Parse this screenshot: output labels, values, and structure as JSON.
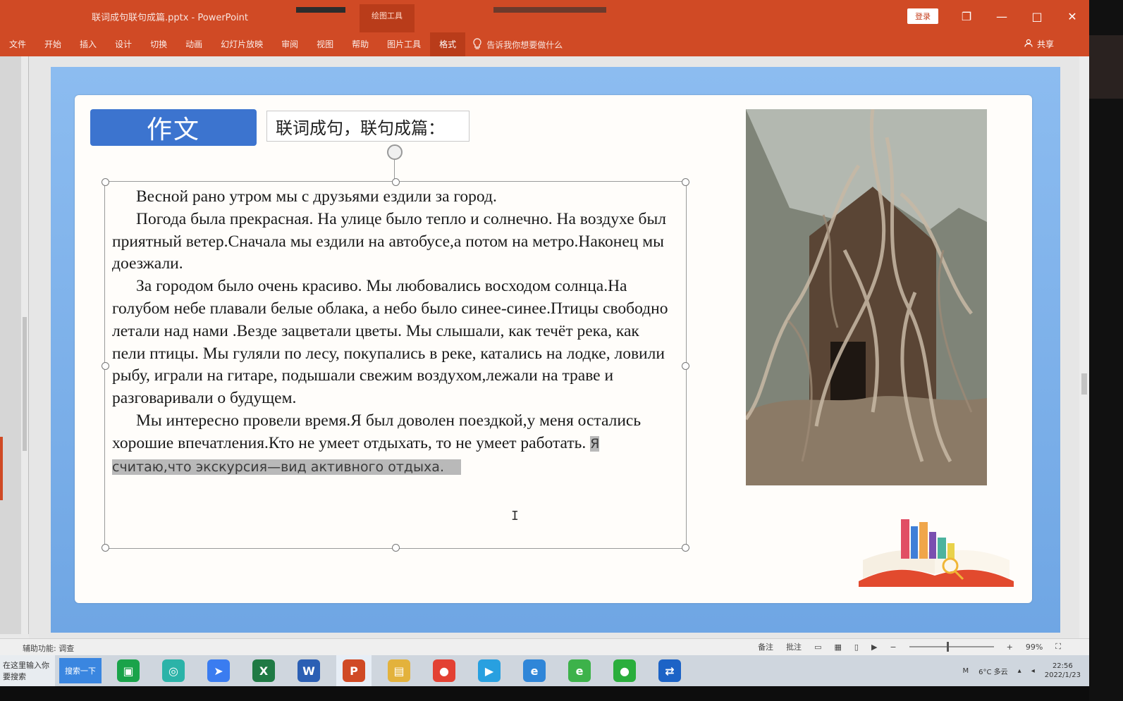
{
  "titlebar": {
    "doc_title": "联词成句联句成篇.pptx - PowerPoint",
    "context_tab": "绘图工具",
    "signin": "登录",
    "restore_icon": "❐",
    "minimize_icon": "—",
    "maximize_icon": "□",
    "close_icon": "✕"
  },
  "ribbon": {
    "tabs": [
      "文件",
      "开始",
      "插入",
      "设计",
      "切换",
      "动画",
      "幻灯片放映",
      "审阅",
      "视图",
      "帮助",
      "图片工具",
      "格式"
    ],
    "active_tab_index": 11,
    "tell_me": "告诉我你想要做什么",
    "share": "共享"
  },
  "slide": {
    "heading": "作文",
    "subtitle": "联词成句，联句成篇：",
    "paragraphs": [
      "Весной рано утром мы с друзьями ездили за город.",
      "Погода была прекрасная. На улице было тепло и солнечно. На воздухе был приятный ветер.Сначала мы ездили на автобусе,а потом на метро.Наконец мы доезжали.",
      "За городом было очень красиво. Мы любовались восходом солнца.На голубом небе плавали белые облака, а небо было синее-синее.Птицы свободно летали над нами .Везде зацветали цветы. Мы слышали, как течёт река, как пели птицы. Мы гуляли по лесу, покупались в реке, катались на лодке, ловили рыбу, играли на гитаре, подышали свежим воздухом,лежали на траве и разговаривали о будущем.",
      "Мы интересно провели время.Я был доволен поездкой,у меня остались хорошие впечатления.Кто не умеет отдыхать, то не умеет работать. "
    ],
    "highlighted_text": "Я считаю,что экскурсия—вид активного отдыха.",
    "photo_icon": "tree-temple-photo",
    "decor_icon": "books-illustration"
  },
  "statusbar": {
    "accessibility": "辅助功能: 调查",
    "notes": "备注",
    "comments": "批注",
    "zoom_percent": "99%",
    "zoom_level": 0.46
  },
  "taskbar": {
    "search_hint": "在这里输入你要搜索",
    "search_button": "搜索一下",
    "apps": [
      {
        "name": "wechat-work",
        "glyph": "▣",
        "color": "#1aa34a"
      },
      {
        "name": "browser-360",
        "glyph": "◎",
        "color": "#2bb3a8"
      },
      {
        "name": "feishu",
        "glyph": "➤",
        "color": "#3a7cf0"
      },
      {
        "name": "excel",
        "glyph": "X",
        "color": "#1f7a44"
      },
      {
        "name": "word",
        "glyph": "W",
        "color": "#2b5fb4"
      },
      {
        "name": "powerpoint",
        "glyph": "P",
        "color": "#d04a25"
      },
      {
        "name": "file-explorer",
        "glyph": "▤",
        "color": "#e3b23c"
      },
      {
        "name": "chrome",
        "glyph": "●",
        "color": "#e34133"
      },
      {
        "name": "media-player",
        "glyph": "▶",
        "color": "#28a0e0"
      },
      {
        "name": "ie",
        "glyph": "e",
        "color": "#2f86d8"
      },
      {
        "name": "edge",
        "glyph": "e",
        "color": "#3db24a"
      },
      {
        "name": "wechat",
        "glyph": "●",
        "color": "#2aae3c"
      },
      {
        "name": "teamviewer",
        "glyph": "⇄",
        "color": "#1c63c6"
      }
    ],
    "active_app_index": 5,
    "tray_weather": "6°C 多云",
    "tray_ime": "M",
    "clock_time": "22:56",
    "clock_date": "2022/1/23"
  },
  "colors": {
    "ppt_orange": "#d04a25",
    "slide_blue": "#7aaeea",
    "heading_blue": "#3c74cf"
  }
}
